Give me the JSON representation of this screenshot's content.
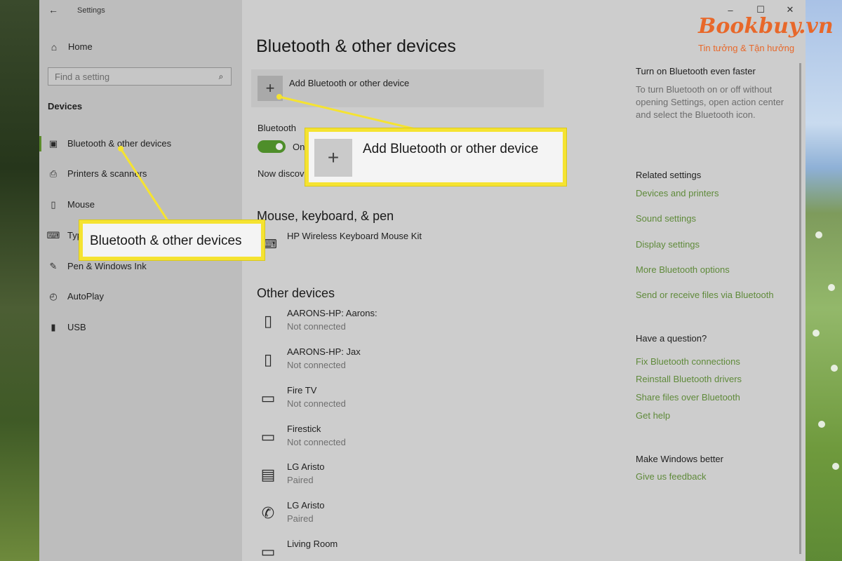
{
  "window": {
    "title": "Settings",
    "back_glyph": "←",
    "minimize_glyph": "–",
    "maximize_glyph": "☐",
    "close_glyph": "✕"
  },
  "sidebar": {
    "home_label": "Home",
    "search_placeholder": "Find a setting",
    "section_title": "Devices",
    "items": [
      {
        "label": "Bluetooth & other devices",
        "icon": "bluetooth-devices-icon",
        "active": true
      },
      {
        "label": "Printers & scanners",
        "icon": "printer-icon"
      },
      {
        "label": "Mouse",
        "icon": "mouse-icon"
      },
      {
        "label": "Typing",
        "icon": "keyboard-icon"
      },
      {
        "label": "Pen & Windows Ink",
        "icon": "pen-icon"
      },
      {
        "label": "AutoPlay",
        "icon": "autoplay-icon"
      },
      {
        "label": "USB",
        "icon": "usb-icon"
      }
    ]
  },
  "main": {
    "title": "Bluetooth & other devices",
    "add_device_label": "Add Bluetooth or other device",
    "bluetooth_label": "Bluetooth",
    "bluetooth_toggle_state": "On",
    "discoverable_text": "Now discoverable as",
    "mouse_section_title": "Mouse, keyboard, & pen",
    "mouse_devices": [
      {
        "name": "HP Wireless Keyboard Mouse Kit",
        "icon": "keyboard-icon"
      }
    ],
    "other_section_title": "Other devices",
    "other_devices": [
      {
        "name": "AARONS-HP: Aarons:",
        "status": "Not connected",
        "icon": "media-device-icon"
      },
      {
        "name": "AARONS-HP: Jax",
        "status": "Not connected",
        "icon": "media-device-icon"
      },
      {
        "name": "Fire TV",
        "status": "Not connected",
        "icon": "tv-audio-icon"
      },
      {
        "name": "Firestick",
        "status": "Not connected",
        "icon": "tv-audio-icon"
      },
      {
        "name": "LG Aristo",
        "status": "Paired",
        "icon": "phone-device-icon"
      },
      {
        "name": "LG Aristo",
        "status": "Paired",
        "icon": "phone-handset-icon"
      },
      {
        "name": "Living Room",
        "status": "",
        "icon": "tv-audio-icon"
      }
    ]
  },
  "right_panel": {
    "tip_title": "Turn on Bluetooth even faster",
    "tip_text": "To turn Bluetooth on or off without opening Settings, open action center and select the Bluetooth icon.",
    "related_title": "Related settings",
    "related_links": [
      "Devices and printers",
      "Sound settings",
      "Display settings",
      "More Bluetooth options",
      "Send or receive files via Bluetooth"
    ],
    "question_title": "Have a question?",
    "question_links": [
      "Fix Bluetooth connections",
      "Reinstall Bluetooth drivers",
      "Share files over Bluetooth",
      "Get help"
    ],
    "better_title": "Make Windows better",
    "feedback_link": "Give us feedback"
  },
  "callouts": {
    "add_label": "Add Bluetooth or other device",
    "sidebar_label": "Bluetooth & other devices"
  },
  "watermark": {
    "brand": "Bookbuy.vn",
    "tagline": "Tin tưởng & Tận hưởng"
  },
  "colors": {
    "accent_green": "#4e8e2a",
    "link_green": "#5f8a3a",
    "highlight_yellow": "#f5e331",
    "brand_orange": "#e8682a"
  }
}
